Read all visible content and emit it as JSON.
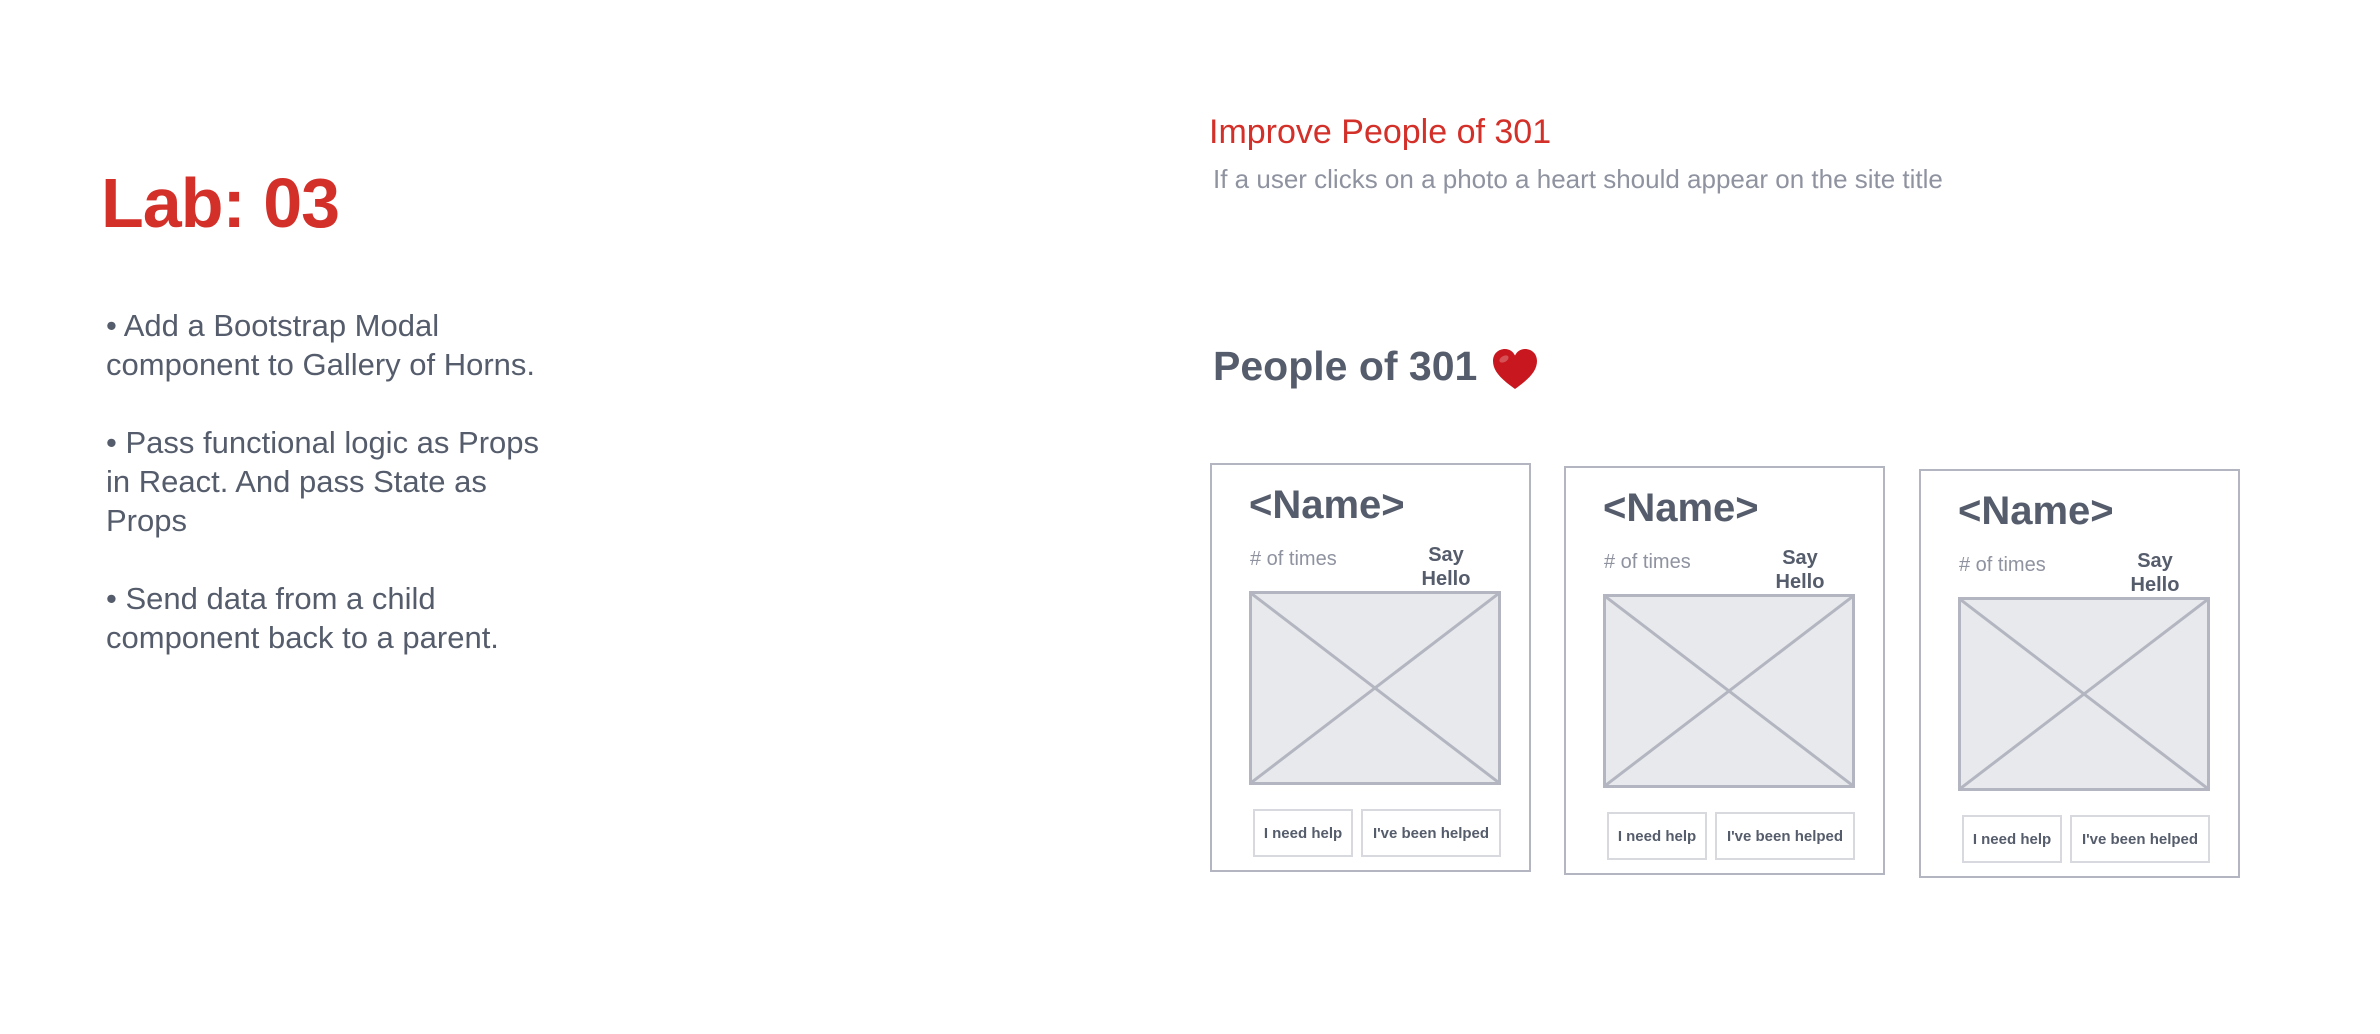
{
  "colors": {
    "accent_red": "#d3302a",
    "text_dark": "#555c6b",
    "text_muted": "#8f93a0",
    "border_gray": "#b3b6c0",
    "placeholder_fill": "#e8e9ec",
    "heart_red": "#c8171e"
  },
  "lab": {
    "title": "Lab: 03",
    "bullets": [
      "• Add a Bootstrap Modal component to Gallery of Horns.",
      "• Pass functional logic as Props in React. And pass State as Props",
      "• Send data from a child component back to a parent."
    ]
  },
  "improve": {
    "title": "Improve People of 301",
    "description": "If a user clicks on a photo a heart should appear on the site title"
  },
  "site": {
    "title": "People of 301",
    "heart_icon": "heart-icon"
  },
  "cards": [
    {
      "name": "<Name>",
      "times_label": "# of times",
      "say_hello": "Say Hello",
      "photo_icon": "image-placeholder-icon",
      "help_label": "I need help",
      "helped_label": "I've been helped"
    },
    {
      "name": "<Name>",
      "times_label": "# of times",
      "say_hello": "Say Hello",
      "photo_icon": "image-placeholder-icon",
      "help_label": "I need help",
      "helped_label": "I've been helped"
    },
    {
      "name": "<Name>",
      "times_label": "# of times",
      "say_hello": "Say Hello",
      "photo_icon": "image-placeholder-icon",
      "help_label": "I need help",
      "helped_label": "I've been helped"
    }
  ]
}
